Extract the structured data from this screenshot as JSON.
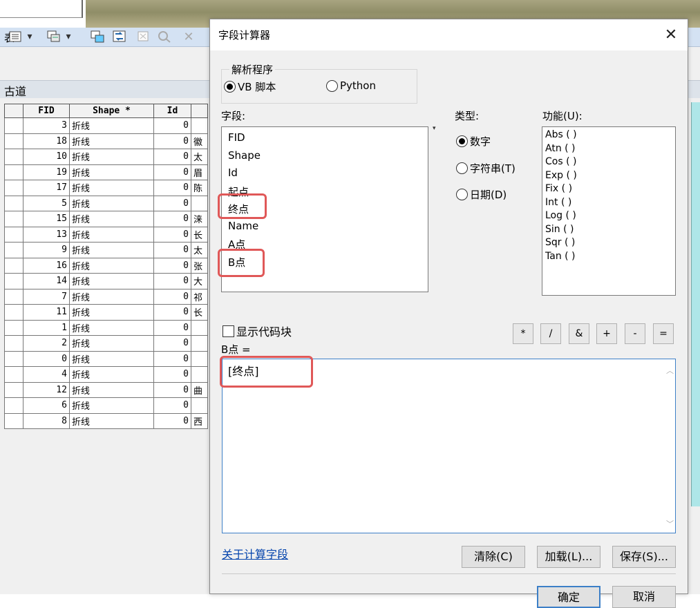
{
  "table_window": {
    "title": "表",
    "table_name": "古道",
    "columns": [
      "FID",
      "Shape *",
      "Id"
    ],
    "rows": [
      {
        "fid": "3",
        "shape": "折线",
        "id": "0",
        "name": ""
      },
      {
        "fid": "18",
        "shape": "折线",
        "id": "0",
        "name": "徽"
      },
      {
        "fid": "10",
        "shape": "折线",
        "id": "0",
        "name": "太"
      },
      {
        "fid": "19",
        "shape": "折线",
        "id": "0",
        "name": "眉"
      },
      {
        "fid": "17",
        "shape": "折线",
        "id": "0",
        "name": "陈"
      },
      {
        "fid": "5",
        "shape": "折线",
        "id": "0",
        "name": ""
      },
      {
        "fid": "15",
        "shape": "折线",
        "id": "0",
        "name": "涞"
      },
      {
        "fid": "13",
        "shape": "折线",
        "id": "0",
        "name": "长"
      },
      {
        "fid": "9",
        "shape": "折线",
        "id": "0",
        "name": "太"
      },
      {
        "fid": "16",
        "shape": "折线",
        "id": "0",
        "name": "张"
      },
      {
        "fid": "14",
        "shape": "折线",
        "id": "0",
        "name": "大"
      },
      {
        "fid": "7",
        "shape": "折线",
        "id": "0",
        "name": "祁"
      },
      {
        "fid": "11",
        "shape": "折线",
        "id": "0",
        "name": "长"
      },
      {
        "fid": "1",
        "shape": "折线",
        "id": "0",
        "name": ""
      },
      {
        "fid": "2",
        "shape": "折线",
        "id": "0",
        "name": ""
      },
      {
        "fid": "0",
        "shape": "折线",
        "id": "0",
        "name": ""
      },
      {
        "fid": "4",
        "shape": "折线",
        "id": "0",
        "name": ""
      },
      {
        "fid": "12",
        "shape": "折线",
        "id": "0",
        "name": "曲"
      },
      {
        "fid": "6",
        "shape": "折线",
        "id": "0",
        "name": ""
      },
      {
        "fid": "8",
        "shape": "折线",
        "id": "0",
        "name": "西"
      }
    ],
    "toolbar_icons": [
      "table-options-icon",
      "dropdown-arrow-icon",
      "related-tables-icon",
      "dropdown-arrow-icon",
      "select-by-attributes-icon",
      "switch-selection-icon",
      "clear-selection-icon",
      "zoom-to-selected-icon",
      "delete-selected-icon"
    ]
  },
  "dialog": {
    "title": "字段计算器",
    "parser_group": "解析程序",
    "parser_vb": "VB 脚本",
    "parser_python": "Python",
    "fields_label": "字段:",
    "fields": [
      "FID",
      "Shape",
      "Id",
      "起点",
      "终点",
      "Name",
      "A点",
      "B点"
    ],
    "type_label": "类型:",
    "type_number": "数字",
    "type_string": "字符串(T)",
    "type_date": "日期(D)",
    "functions_label": "功能(U):",
    "functions": [
      "Abs ( )",
      "Atn ( )",
      "Cos ( )",
      "Exp ( )",
      "Fix ( )",
      "Int ( )",
      "Log ( )",
      "Sin ( )",
      "Sqr ( )",
      "Tan ( )"
    ],
    "show_codeblock": "显示代码块",
    "operators": [
      "*",
      "/",
      "&",
      "+",
      "-",
      "="
    ],
    "expression_label": "B点 =",
    "expression": "[终点]",
    "help_link": "关于计算字段",
    "clear_button": "清除(C)",
    "load_button": "加载(L)...",
    "save_button": "保存(S)...",
    "ok_button": "确定",
    "cancel_button": "取消"
  },
  "colors": {
    "highlight": "#e05858",
    "link": "#0645ad",
    "title_bar": "#d4e2f3"
  }
}
